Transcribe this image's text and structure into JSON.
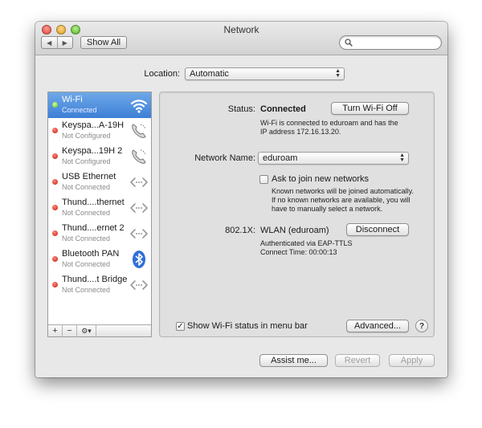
{
  "window": {
    "title": "Network"
  },
  "toolbar": {
    "back": "◀",
    "forward": "▶",
    "show_all": "Show All",
    "search_placeholder": ""
  },
  "location": {
    "label": "Location:",
    "value": "Automatic"
  },
  "services": [
    {
      "name": "Wi-Fi",
      "status": "Connected",
      "dot": "green",
      "icon": "wifi-icon",
      "selected": true
    },
    {
      "name": "Keyspa...A-19H",
      "status": "Not Configured",
      "dot": "red",
      "icon": "phone-icon"
    },
    {
      "name": "Keyspa...19H 2",
      "status": "Not Configured",
      "dot": "red",
      "icon": "phone-icon"
    },
    {
      "name": "USB Ethernet",
      "status": "Not Connected",
      "dot": "red",
      "icon": "ethernet-arrows-icon"
    },
    {
      "name": "Thund....thernet",
      "status": "Not Connected",
      "dot": "red",
      "icon": "ethernet-arrows-icon"
    },
    {
      "name": "Thund....ernet 2",
      "status": "Not Connected",
      "dot": "red",
      "icon": "ethernet-arrows-icon"
    },
    {
      "name": "Bluetooth PAN",
      "status": "Not Connected",
      "dot": "red",
      "icon": "bluetooth-icon"
    },
    {
      "name": "Thund....t Bridge",
      "status": "Not Connected",
      "dot": "red",
      "icon": "ethernet-arrows-icon"
    }
  ],
  "sidebar_footer": {
    "add": "+",
    "remove": "−",
    "gear": "⚙▾"
  },
  "detail": {
    "status_label": "Status:",
    "status_value": "Connected",
    "turn_off_button": "Turn Wi-Fi Off",
    "status_desc_1": "Wi-Fi is connected to eduroam and has the",
    "status_desc_2": "IP address 172.16.13.20.",
    "network_name_label": "Network Name:",
    "network_name_value": "eduroam",
    "ask_join_label": "Ask to join new networks",
    "ask_join_checked": false,
    "ask_desc_1": "Known networks will be joined automatically.",
    "ask_desc_2": "If no known networks are available, you will",
    "ask_desc_3": "have to manually select a network.",
    "dot1x_label": "802.1X:",
    "dot1x_value": "WLAN (eduroam)",
    "disconnect_button": "Disconnect",
    "auth_line": "Authenticated via EAP-TTLS",
    "connect_time": "Connect Time: 00:00:13",
    "show_status_label": "Show Wi-Fi status in menu bar",
    "show_status_checked": true,
    "advanced_button": "Advanced...",
    "help_button": "?"
  },
  "buttons": {
    "assist": "Assist me...",
    "revert": "Revert",
    "apply": "Apply"
  },
  "colors": {
    "selection": "#3d7fd6",
    "connected_dot": "#5cc520",
    "disconnected_dot": "#c6150a"
  }
}
